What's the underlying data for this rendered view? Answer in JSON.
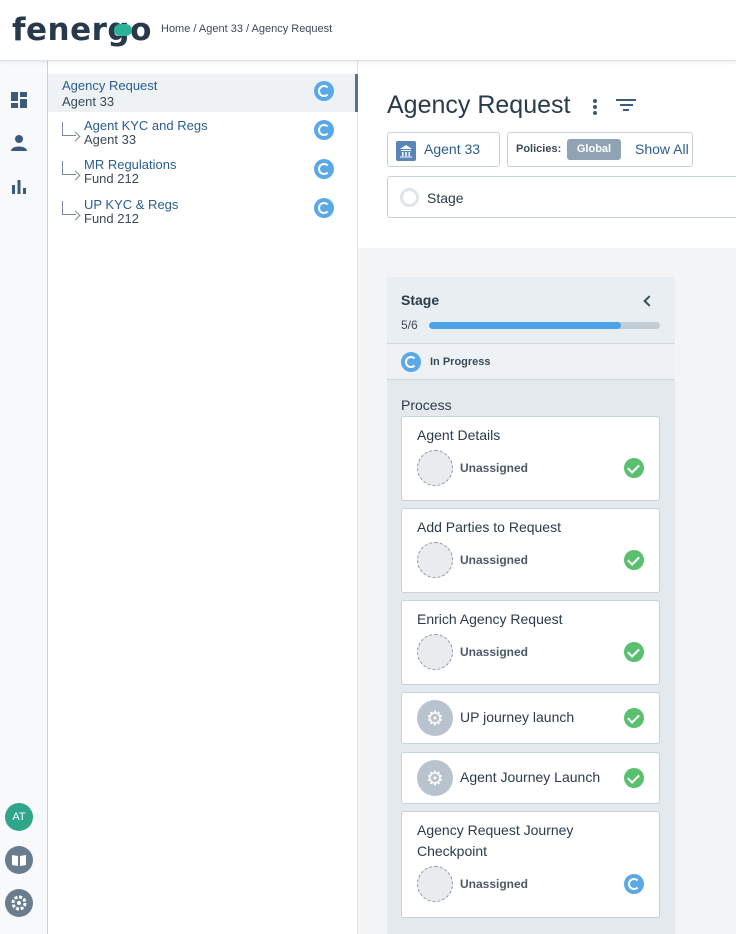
{
  "brand": {
    "logo_text": "fenergo",
    "accent": "#2bb39a"
  },
  "breadcrumb": "Home / Agent 33 / Agency Request",
  "leftnav": {
    "icons": [
      "dashboard-icon",
      "person-icon",
      "bar-chart-icon"
    ],
    "avatar_initials": "AT",
    "bottom_icons": [
      "book-icon",
      "gear-icon"
    ]
  },
  "tree": {
    "items": [
      {
        "title": "Agency Request",
        "sub": "Agent 33",
        "active": true
      },
      {
        "title": "Agent KYC and Regs",
        "sub": "Agent 33"
      },
      {
        "title": "MR Regulations",
        "sub": "Fund 212"
      },
      {
        "title": "UP KYC & Regs",
        "sub": "Fund 212"
      }
    ]
  },
  "header": {
    "title": "Agency Request",
    "entity_chip": "Agent 33",
    "policies_label": "Policies:",
    "policies_value": "Global",
    "show_all": "Show All",
    "stage_label": "Stage"
  },
  "panel": {
    "stage_title": "Stage",
    "progress_text": "5/6",
    "progress_fraction": 0.833,
    "status": "In Progress",
    "process_label": "Process",
    "cards": [
      {
        "title": "Agent Details",
        "assignee": "Unassigned",
        "state": "complete"
      },
      {
        "title": "Add Parties to Request",
        "assignee": "Unassigned",
        "state": "complete"
      },
      {
        "title": "Enrich Agency Request",
        "assignee": "Unassigned",
        "state": "complete"
      },
      {
        "title": "UP journey launch",
        "state": "complete",
        "system": true
      },
      {
        "title": "Agent Journey Launch",
        "state": "complete",
        "system": true
      },
      {
        "title": "Agency Request Journey Checkpoint",
        "assignee": "Unassigned",
        "state": "in-progress"
      }
    ]
  },
  "colors": {
    "progress": "#4aa3e8",
    "complete": "#58c06e",
    "in_progress": "#5aa9e6"
  }
}
